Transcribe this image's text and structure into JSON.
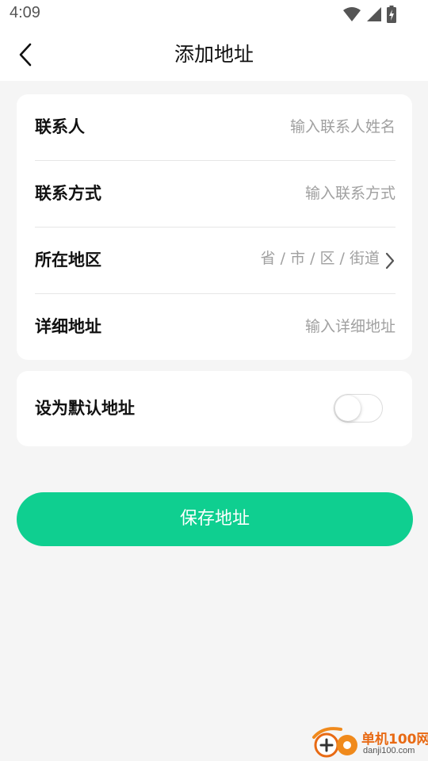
{
  "status_bar": {
    "time": "4:09",
    "icons": [
      "wifi-icon",
      "signal-icon",
      "battery-charging-icon"
    ]
  },
  "header": {
    "title": "添加地址",
    "back_icon": "chevron-left-icon"
  },
  "form": {
    "contact": {
      "label": "联系人",
      "placeholder": "输入联系人姓名",
      "value": ""
    },
    "phone": {
      "label": "联系方式",
      "placeholder": "输入联系方式",
      "value": ""
    },
    "region": {
      "label": "所在地区",
      "placeholder": "省 / 市 / 区 / 街道",
      "icon": "chevron-right-icon"
    },
    "detail": {
      "label": "详细地址",
      "placeholder": "输入详细地址",
      "value": ""
    }
  },
  "default_setting": {
    "label": "设为默认地址",
    "enabled": false
  },
  "save_button": {
    "label": "保存地址"
  },
  "watermark": {
    "name": "单机100网",
    "url": "danji100.com"
  },
  "colors": {
    "accent": "#0fcf90",
    "background": "#f5f5f5",
    "placeholder": "#a0a0a0",
    "watermark": "#e86a14"
  }
}
